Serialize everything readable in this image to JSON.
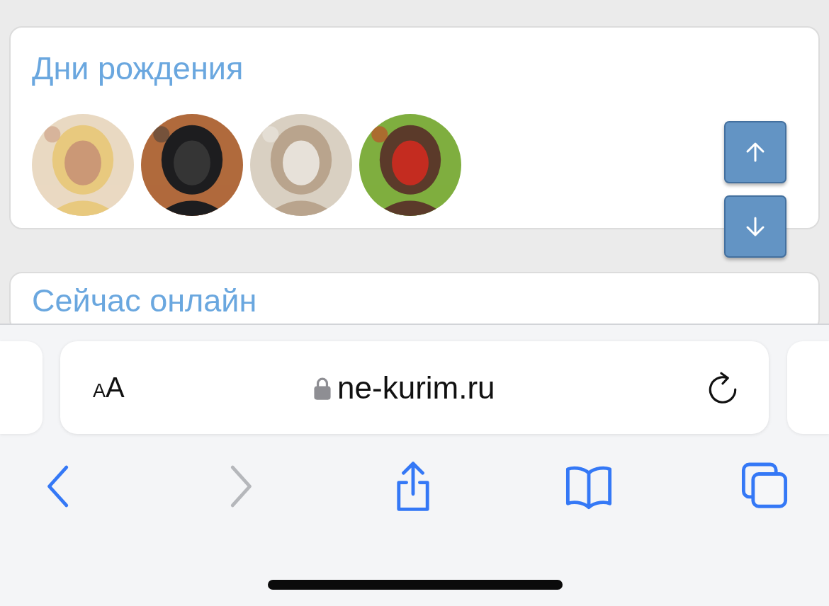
{
  "sections": [
    {
      "title": "Дни рождения"
    },
    {
      "title": "Сейчас онлайн"
    }
  ],
  "scroll_buttons": [
    {
      "kind": "up"
    },
    {
      "kind": "down"
    }
  ],
  "browser": {
    "text_size_button": {
      "small": "A",
      "large": "A"
    },
    "url": "ne-kurim.ru",
    "nav": [
      {
        "kind": "back",
        "disabled": false
      },
      {
        "kind": "forward",
        "disabled": true
      },
      {
        "kind": "share",
        "disabled": false
      },
      {
        "kind": "bookmarks",
        "disabled": false
      },
      {
        "kind": "tabs",
        "disabled": false
      }
    ]
  }
}
